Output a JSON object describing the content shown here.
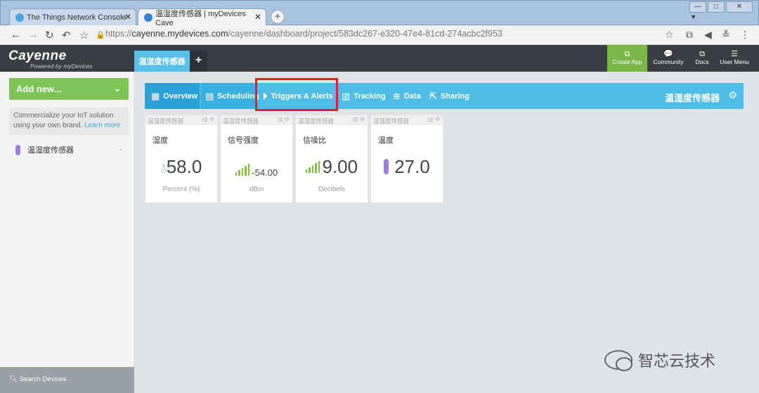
{
  "browser": {
    "tabs": [
      {
        "title": "The Things Network Console"
      },
      {
        "title": "温湿度传感器 | myDevices Caye"
      }
    ],
    "url_prefix": "https://",
    "url_host": "cayenne.mydevices.com",
    "url_path": "/cayenne/dashboard/project/583dc267-e320-47e4-81cd-274acbc2f953"
  },
  "header": {
    "logo": "Cayenne",
    "logo_sub": "Powered by myDevices",
    "project_tab": "温湿度传感器",
    "add_project": "+",
    "create_app": "Create App",
    "community": "Community",
    "docs": "Docs",
    "user_menu": "User Menu"
  },
  "sidebar": {
    "add_new": "Add new...",
    "promo_text": "Commercialize your IoT solution using your own brand.",
    "promo_link": "Learn more",
    "device_name": "温湿度传感器",
    "search": "Search Devices"
  },
  "dashboard": {
    "tabs": [
      {
        "label": "Overview",
        "icon": "overview-icon"
      },
      {
        "label": "Scheduling",
        "icon": "calendar-icon"
      },
      {
        "label": "Triggers & Alerts",
        "icon": "play-circle-icon"
      },
      {
        "label": "Tracking",
        "icon": "map-icon"
      },
      {
        "label": "Data",
        "icon": "database-icon"
      },
      {
        "label": "Sharing",
        "icon": "share-icon"
      }
    ],
    "title": "温湿度传感器"
  },
  "widgets": [
    {
      "source": "温湿度传感器",
      "title": "湿度",
      "value": "58.0",
      "unit": "Percent (%)",
      "icon": "water-drop-icon"
    },
    {
      "source": "温湿度传感器",
      "title": "信号强度",
      "value": "-54.00",
      "unit": "dBm",
      "icon": "signal-bars-icon"
    },
    {
      "source": "温湿度传感器",
      "title": "信噪比",
      "value": "9.00",
      "unit": "Decibels",
      "icon": "signal-bars-icon"
    },
    {
      "source": "温湿度传感器",
      "title": "温度",
      "value": "27.0",
      "unit": "",
      "icon": "thermometer-icon"
    }
  ],
  "watermark": "智芯云技术",
  "colors": {
    "accent_blue": "#4dbde6",
    "accent_green": "#7ec356",
    "highlight_red": "#e31e24",
    "header_dark": "#3a3d44"
  }
}
